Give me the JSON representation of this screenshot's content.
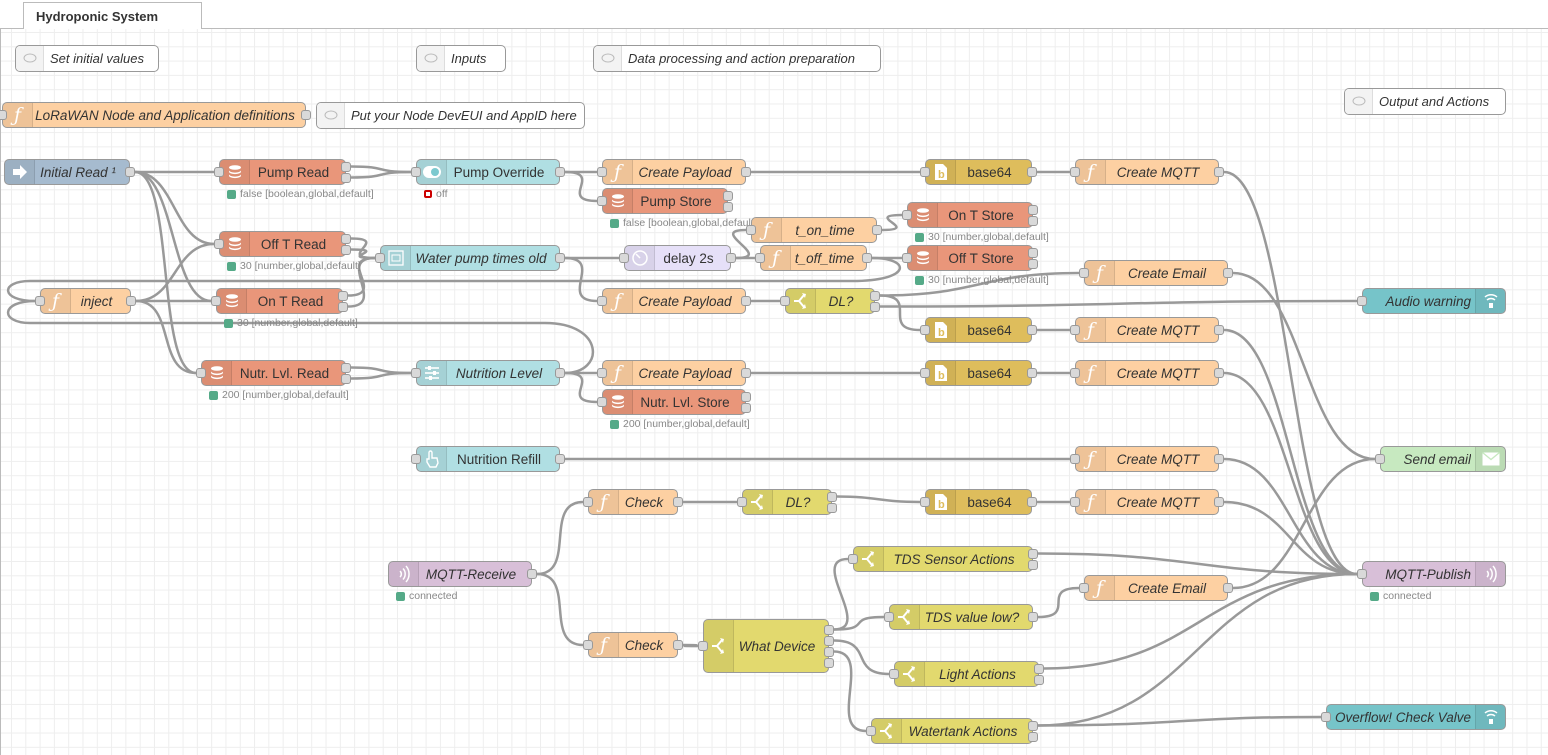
{
  "tab": {
    "title": "Hydroponic System"
  },
  "comments": [
    {
      "id": "c1",
      "label": "Set initial values"
    },
    {
      "id": "c2",
      "label": "Inputs"
    },
    {
      "id": "c3",
      "label": "Data processing and action preparation"
    },
    {
      "id": "c4",
      "label": "Put your Node DevEUI and AppID here"
    },
    {
      "id": "c5",
      "label": "Output and Actions"
    }
  ],
  "nodes": {
    "lorawan_defs": {
      "label": "LoRaWAN Node and Application definitions",
      "type": "function",
      "icon": "function-icon"
    },
    "initial_read": {
      "label": "Initial Read ¹",
      "type": "inject",
      "icon": "inject-arrow-icon"
    },
    "inject_fn": {
      "label": "inject",
      "type": "function",
      "icon": "function-icon"
    },
    "pump_read": {
      "label": "Pump Read",
      "type": "global-store",
      "icon": "database-icon",
      "status": "false [boolean,global,default]"
    },
    "off_t_read": {
      "label": "Off T Read",
      "type": "global-store",
      "icon": "database-icon",
      "status": "30 [number,global,default]"
    },
    "on_t_read": {
      "label": "On T Read",
      "type": "global-store",
      "icon": "database-icon",
      "status": "30 [number,global,default]"
    },
    "nutr_read": {
      "label": "Nutr. Lvl. Read",
      "type": "global-store",
      "icon": "database-icon",
      "status": "200 [number,global,default]"
    },
    "pump_override": {
      "label": "Pump Override",
      "type": "dashboard-switch",
      "icon": "toggle-icon",
      "status": "off"
    },
    "water_pump_times": {
      "label": "Water pump times old",
      "type": "dashboard-form",
      "icon": "form-icon"
    },
    "nutrition_level": {
      "label": "Nutrition Level",
      "type": "dashboard-slider",
      "icon": "slider-icon"
    },
    "nutrition_refill": {
      "label": "Nutrition Refill",
      "type": "dashboard-button",
      "icon": "hand-pointer-icon"
    },
    "mqtt_receive": {
      "label": "MQTT-Receive",
      "type": "mqtt-in",
      "icon": "mqtt-signal-icon",
      "status": "connected"
    },
    "create_payload_1": {
      "label": "Create Payload",
      "type": "function",
      "icon": "function-icon"
    },
    "pump_store": {
      "label": "Pump Store",
      "type": "global-store",
      "icon": "database-icon",
      "status": "false [boolean,global,default]"
    },
    "delay_2s": {
      "label": "delay 2s",
      "type": "delay",
      "icon": "clock-icon"
    },
    "t_on_time": {
      "label": "t_on_time",
      "type": "function",
      "icon": "function-icon"
    },
    "t_off_time": {
      "label": "t_off_time",
      "type": "function",
      "icon": "function-icon"
    },
    "on_t_store": {
      "label": "On T Store",
      "type": "global-store",
      "icon": "database-icon",
      "status": "30 [number,global,default]"
    },
    "off_t_store": {
      "label": "Off T Store",
      "type": "global-store",
      "icon": "database-icon",
      "status": "30 [number,global,default]"
    },
    "create_payload_2": {
      "label": "Create Payload",
      "type": "function",
      "icon": "function-icon"
    },
    "dl_1": {
      "label": "DL?",
      "type": "switch",
      "icon": "switch-icon"
    },
    "create_payload_3": {
      "label": "Create Payload",
      "type": "function",
      "icon": "function-icon"
    },
    "nutr_store": {
      "label": "Nutr. Lvl. Store",
      "type": "global-store",
      "icon": "database-icon",
      "status": "200 [number,global,default]"
    },
    "check_1": {
      "label": "Check",
      "type": "function",
      "icon": "function-icon"
    },
    "dl_2": {
      "label": "DL?",
      "type": "switch",
      "icon": "switch-icon"
    },
    "check_2": {
      "label": "Check",
      "type": "function",
      "icon": "function-icon"
    },
    "what_device": {
      "label": "What Device",
      "type": "switch",
      "icon": "switch-icon"
    },
    "tds_sensor_actions": {
      "label": "TDS Sensor Actions",
      "type": "switch",
      "icon": "switch-icon"
    },
    "tds_value_low": {
      "label": "TDS value low?",
      "type": "switch",
      "icon": "switch-icon"
    },
    "light_actions": {
      "label": "Light Actions",
      "type": "switch",
      "icon": "switch-icon"
    },
    "watertank_actions": {
      "label": "Watertank Actions",
      "type": "switch",
      "icon": "switch-icon"
    },
    "base64_1": {
      "label": "base64",
      "type": "base64",
      "icon": "base64-icon"
    },
    "base64_2": {
      "label": "base64",
      "type": "base64",
      "icon": "base64-icon"
    },
    "base64_3": {
      "label": "base64",
      "type": "base64",
      "icon": "base64-icon"
    },
    "base64_4": {
      "label": "base64",
      "type": "base64",
      "icon": "base64-icon"
    },
    "create_mqtt_1": {
      "label": "Create MQTT",
      "type": "function",
      "icon": "function-icon"
    },
    "create_email_1": {
      "label": "Create Email",
      "type": "function",
      "icon": "function-icon"
    },
    "create_mqtt_2": {
      "label": "Create MQTT",
      "type": "function",
      "icon": "function-icon"
    },
    "create_mqtt_3": {
      "label": "Create MQTT",
      "type": "function",
      "icon": "function-icon"
    },
    "create_mqtt_4": {
      "label": "Create MQTT",
      "type": "function",
      "icon": "function-icon"
    },
    "create_mqtt_5": {
      "label": "Create MQTT",
      "type": "function",
      "icon": "function-icon"
    },
    "create_email_2": {
      "label": "Create Email",
      "type": "function",
      "icon": "function-icon"
    },
    "audio_warning": {
      "label": "Audio warning",
      "type": "dashboard-audio",
      "icon": "audio-icon"
    },
    "send_email": {
      "label": "Send email",
      "type": "email",
      "icon": "envelope-icon"
    },
    "mqtt_publish": {
      "label": "MQTT-Publish",
      "type": "mqtt-out",
      "icon": "mqtt-signal-icon",
      "status": "connected"
    },
    "overflow_check": {
      "label": "Overflow! Check Valve",
      "type": "dashboard-audio",
      "icon": "audio-icon"
    }
  },
  "colors": {
    "function": "#fdd0a2",
    "global_store": "#e9967a",
    "inject": "#a6bbcf",
    "dashboard": "#b0dfe3",
    "delay": "#e6e0f8",
    "base64": "#debd5c",
    "switch": "#e2d96e",
    "audio": "#76c4c9",
    "email": "#c7e9c0",
    "mqtt": "#d8bfd8",
    "status_ok": "#55aa88",
    "status_off": "#cc0000",
    "wire": "#999999"
  }
}
